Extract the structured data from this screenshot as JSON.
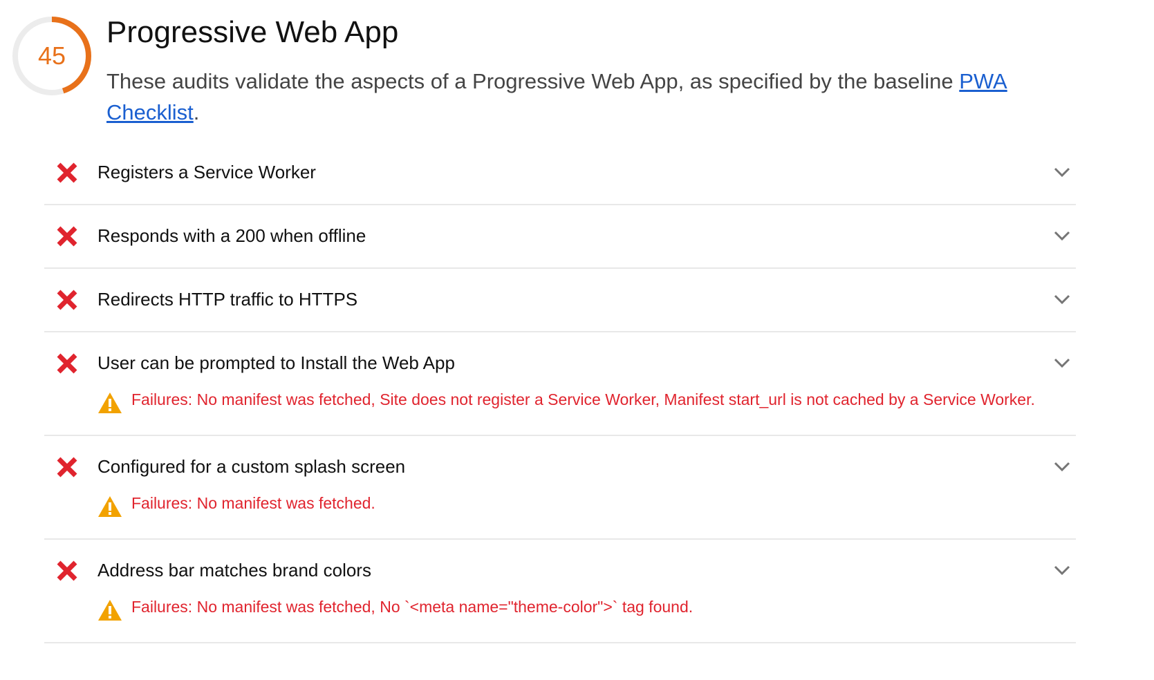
{
  "category": {
    "score": "45",
    "score_fraction": 0.45,
    "score_color": "#e8711a",
    "title": "Progressive Web App",
    "description_text": "These audits validate the aspects of a Progressive Web App, as specified by the baseline ",
    "description_link": "PWA Checklist",
    "description_end": "."
  },
  "colors": {
    "fail": "#e0242e",
    "warning": "#f2a200",
    "link": "#1a5fd0"
  },
  "audits": [
    {
      "title": "Registers a Service Worker",
      "status_icon": "fail-icon",
      "failure": null
    },
    {
      "title": "Responds with a 200 when offline",
      "status_icon": "fail-icon",
      "failure": null
    },
    {
      "title": "Redirects HTTP traffic to HTTPS",
      "status_icon": "fail-icon",
      "failure": null
    },
    {
      "title": "User can be prompted to Install the Web App",
      "status_icon": "fail-icon",
      "failure": "Failures: No manifest was fetched, Site does not register a Service Worker, Manifest start_url is not cached by a Service Worker."
    },
    {
      "title": "Configured for a custom splash screen",
      "status_icon": "fail-icon",
      "failure": "Failures: No manifest was fetched."
    },
    {
      "title": "Address bar matches brand colors",
      "status_icon": "fail-icon",
      "failure": "Failures: No manifest was fetched, No `<meta name=\"theme-color\">` tag found."
    }
  ]
}
